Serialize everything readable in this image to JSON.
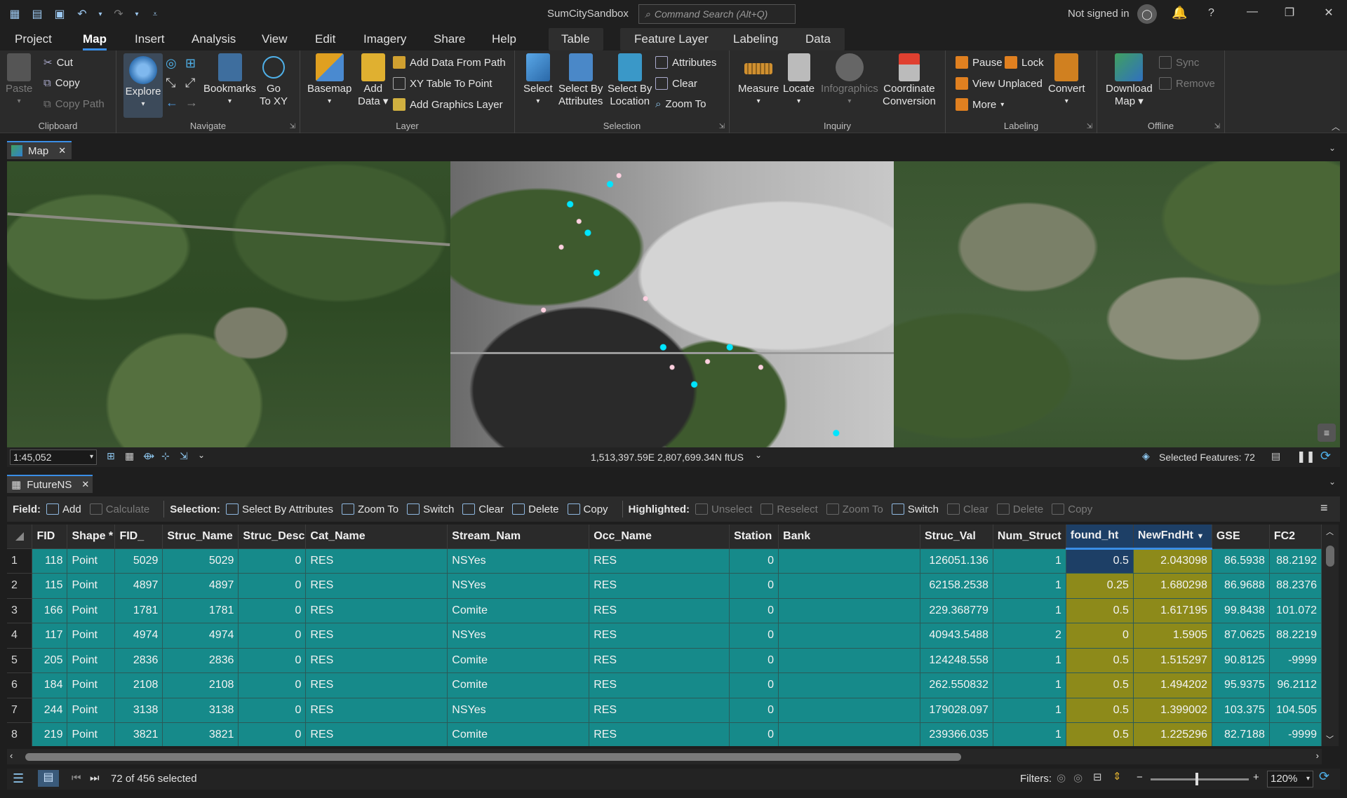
{
  "window": {
    "title": "SumCitySandbox",
    "command_search_placeholder": "Command Search (Alt+Q)",
    "signin": "Not signed in"
  },
  "ribbon_tabs": [
    "Project",
    "Map",
    "Insert",
    "Analysis",
    "View",
    "Edit",
    "Imagery",
    "Share",
    "Help",
    "Table",
    "Feature Layer",
    "Labeling",
    "Data"
  ],
  "ribbon": {
    "clipboard": {
      "label": "Clipboard",
      "paste": "Paste",
      "cut": "Cut",
      "copy": "Copy",
      "copy_path": "Copy Path"
    },
    "navigate": {
      "label": "Navigate",
      "explore": "Explore",
      "bookmarks": "Bookmarks",
      "goto1": "Go",
      "goto2": "To XY"
    },
    "layer": {
      "label": "Layer",
      "basemap": "Basemap",
      "add1": "Add",
      "add2": "Data",
      "add_path": "Add Data From Path",
      "xy": "XY Table To Point",
      "graphics": "Add Graphics Layer"
    },
    "selection": {
      "label": "Selection",
      "select": "Select",
      "sba1": "Select By",
      "sba2": "Attributes",
      "sbl1": "Select By",
      "sbl2": "Location",
      "attributes": "Attributes",
      "clear": "Clear",
      "zoom": "Zoom To"
    },
    "inquiry": {
      "label": "Inquiry",
      "measure": "Measure",
      "locate": "Locate",
      "infographics": "Infographics",
      "coord1": "Coordinate",
      "coord2": "Conversion"
    },
    "labeling": {
      "label": "Labeling",
      "pause": "Pause",
      "lock": "Lock",
      "unplaced": "View Unplaced",
      "more": "More",
      "convert": "Convert"
    },
    "offline": {
      "label": "Offline",
      "dl1": "Download",
      "dl2": "Map",
      "sync": "Sync",
      "remove": "Remove"
    }
  },
  "map": {
    "tab": "Map",
    "scale": "1:45,052",
    "coords": "1,513,397.59E 2,807,699.34N ftUS",
    "selected": "Selected Features: 72"
  },
  "table": {
    "tab": "FutureNS",
    "toolbar": {
      "field": "Field:",
      "add": "Add",
      "calculate": "Calculate",
      "selection": "Selection:",
      "sba": "Select By Attributes",
      "zoom": "Zoom To",
      "switch": "Switch",
      "clear": "Clear",
      "delete": "Delete",
      "copy": "Copy",
      "highlighted": "Highlighted:",
      "unselect": "Unselect",
      "reselect": "Reselect",
      "hzoom": "Zoom To",
      "hswitch": "Switch",
      "hclear": "Clear",
      "hdelete": "Delete",
      "hcopy": "Copy"
    },
    "columns": [
      "FID",
      "Shape *",
      "FID_",
      "Struc_Name",
      "Struc_Desc",
      "Cat_Name",
      "Stream_Nam",
      "Occ_Name",
      "Station",
      "Bank",
      "Struc_Val",
      "Num_Struct",
      "found_ht",
      "NewFndHt",
      "GSE",
      "FC2"
    ],
    "rows": [
      [
        "1",
        "118",
        "Point",
        "5029",
        "5029",
        "0",
        "RES",
        "NSYes",
        "RES",
        "0",
        "",
        "126051.136",
        "1",
        "0.5",
        "2.043098",
        "86.5938",
        "88.2192"
      ],
      [
        "2",
        "115",
        "Point",
        "4897",
        "4897",
        "0",
        "RES",
        "NSYes",
        "RES",
        "0",
        "",
        "62158.2538",
        "1",
        "0.25",
        "1.680298",
        "86.9688",
        "88.2376"
      ],
      [
        "3",
        "166",
        "Point",
        "1781",
        "1781",
        "0",
        "RES",
        "Comite",
        "RES",
        "0",
        "",
        "229.368779",
        "1",
        "0.5",
        "1.617195",
        "99.8438",
        "101.072"
      ],
      [
        "4",
        "117",
        "Point",
        "4974",
        "4974",
        "0",
        "RES",
        "NSYes",
        "RES",
        "0",
        "",
        "40943.5488",
        "2",
        "0",
        "1.5905",
        "87.0625",
        "88.2219"
      ],
      [
        "5",
        "205",
        "Point",
        "2836",
        "2836",
        "0",
        "RES",
        "Comite",
        "RES",
        "0",
        "",
        "124248.558",
        "1",
        "0.5",
        "1.515297",
        "90.8125",
        "-9999"
      ],
      [
        "6",
        "184",
        "Point",
        "2108",
        "2108",
        "0",
        "RES",
        "Comite",
        "RES",
        "0",
        "",
        "262.550832",
        "1",
        "0.5",
        "1.494202",
        "95.9375",
        "96.2112"
      ],
      [
        "7",
        "244",
        "Point",
        "3138",
        "3138",
        "0",
        "RES",
        "NSYes",
        "RES",
        "0",
        "",
        "179028.097",
        "1",
        "0.5",
        "1.399002",
        "103.375",
        "104.505"
      ],
      [
        "8",
        "219",
        "Point",
        "3821",
        "3821",
        "0",
        "RES",
        "Comite",
        "RES",
        "0",
        "",
        "239366.035",
        "1",
        "0.5",
        "1.225296",
        "82.7188",
        "-9999"
      ]
    ],
    "status": "72 of 456 selected",
    "filters": "Filters:",
    "zoom": "120%"
  },
  "colors": {
    "accent": "#3a8ee6",
    "selected_row": "#168a8a",
    "highlight_col": "#8d8a1a"
  }
}
